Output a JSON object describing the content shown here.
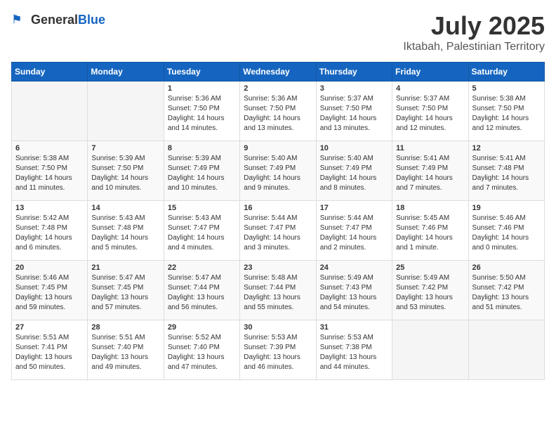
{
  "header": {
    "logo_general": "General",
    "logo_blue": "Blue",
    "month_year": "July 2025",
    "location": "Iktabah, Palestinian Territory"
  },
  "days_of_week": [
    "Sunday",
    "Monday",
    "Tuesday",
    "Wednesday",
    "Thursday",
    "Friday",
    "Saturday"
  ],
  "weeks": [
    [
      {
        "day": "",
        "info": ""
      },
      {
        "day": "",
        "info": ""
      },
      {
        "day": "1",
        "info": "Sunrise: 5:36 AM\nSunset: 7:50 PM\nDaylight: 14 hours\nand 14 minutes."
      },
      {
        "day": "2",
        "info": "Sunrise: 5:36 AM\nSunset: 7:50 PM\nDaylight: 14 hours\nand 13 minutes."
      },
      {
        "day": "3",
        "info": "Sunrise: 5:37 AM\nSunset: 7:50 PM\nDaylight: 14 hours\nand 13 minutes."
      },
      {
        "day": "4",
        "info": "Sunrise: 5:37 AM\nSunset: 7:50 PM\nDaylight: 14 hours\nand 12 minutes."
      },
      {
        "day": "5",
        "info": "Sunrise: 5:38 AM\nSunset: 7:50 PM\nDaylight: 14 hours\nand 12 minutes."
      }
    ],
    [
      {
        "day": "6",
        "info": "Sunrise: 5:38 AM\nSunset: 7:50 PM\nDaylight: 14 hours\nand 11 minutes."
      },
      {
        "day": "7",
        "info": "Sunrise: 5:39 AM\nSunset: 7:50 PM\nDaylight: 14 hours\nand 10 minutes."
      },
      {
        "day": "8",
        "info": "Sunrise: 5:39 AM\nSunset: 7:49 PM\nDaylight: 14 hours\nand 10 minutes."
      },
      {
        "day": "9",
        "info": "Sunrise: 5:40 AM\nSunset: 7:49 PM\nDaylight: 14 hours\nand 9 minutes."
      },
      {
        "day": "10",
        "info": "Sunrise: 5:40 AM\nSunset: 7:49 PM\nDaylight: 14 hours\nand 8 minutes."
      },
      {
        "day": "11",
        "info": "Sunrise: 5:41 AM\nSunset: 7:49 PM\nDaylight: 14 hours\nand 7 minutes."
      },
      {
        "day": "12",
        "info": "Sunrise: 5:41 AM\nSunset: 7:48 PM\nDaylight: 14 hours\nand 7 minutes."
      }
    ],
    [
      {
        "day": "13",
        "info": "Sunrise: 5:42 AM\nSunset: 7:48 PM\nDaylight: 14 hours\nand 6 minutes."
      },
      {
        "day": "14",
        "info": "Sunrise: 5:43 AM\nSunset: 7:48 PM\nDaylight: 14 hours\nand 5 minutes."
      },
      {
        "day": "15",
        "info": "Sunrise: 5:43 AM\nSunset: 7:47 PM\nDaylight: 14 hours\nand 4 minutes."
      },
      {
        "day": "16",
        "info": "Sunrise: 5:44 AM\nSunset: 7:47 PM\nDaylight: 14 hours\nand 3 minutes."
      },
      {
        "day": "17",
        "info": "Sunrise: 5:44 AM\nSunset: 7:47 PM\nDaylight: 14 hours\nand 2 minutes."
      },
      {
        "day": "18",
        "info": "Sunrise: 5:45 AM\nSunset: 7:46 PM\nDaylight: 14 hours\nand 1 minute."
      },
      {
        "day": "19",
        "info": "Sunrise: 5:46 AM\nSunset: 7:46 PM\nDaylight: 14 hours\nand 0 minutes."
      }
    ],
    [
      {
        "day": "20",
        "info": "Sunrise: 5:46 AM\nSunset: 7:45 PM\nDaylight: 13 hours\nand 59 minutes."
      },
      {
        "day": "21",
        "info": "Sunrise: 5:47 AM\nSunset: 7:45 PM\nDaylight: 13 hours\nand 57 minutes."
      },
      {
        "day": "22",
        "info": "Sunrise: 5:47 AM\nSunset: 7:44 PM\nDaylight: 13 hours\nand 56 minutes."
      },
      {
        "day": "23",
        "info": "Sunrise: 5:48 AM\nSunset: 7:44 PM\nDaylight: 13 hours\nand 55 minutes."
      },
      {
        "day": "24",
        "info": "Sunrise: 5:49 AM\nSunset: 7:43 PM\nDaylight: 13 hours\nand 54 minutes."
      },
      {
        "day": "25",
        "info": "Sunrise: 5:49 AM\nSunset: 7:42 PM\nDaylight: 13 hours\nand 53 minutes."
      },
      {
        "day": "26",
        "info": "Sunrise: 5:50 AM\nSunset: 7:42 PM\nDaylight: 13 hours\nand 51 minutes."
      }
    ],
    [
      {
        "day": "27",
        "info": "Sunrise: 5:51 AM\nSunset: 7:41 PM\nDaylight: 13 hours\nand 50 minutes."
      },
      {
        "day": "28",
        "info": "Sunrise: 5:51 AM\nSunset: 7:40 PM\nDaylight: 13 hours\nand 49 minutes."
      },
      {
        "day": "29",
        "info": "Sunrise: 5:52 AM\nSunset: 7:40 PM\nDaylight: 13 hours\nand 47 minutes."
      },
      {
        "day": "30",
        "info": "Sunrise: 5:53 AM\nSunset: 7:39 PM\nDaylight: 13 hours\nand 46 minutes."
      },
      {
        "day": "31",
        "info": "Sunrise: 5:53 AM\nSunset: 7:38 PM\nDaylight: 13 hours\nand 44 minutes."
      },
      {
        "day": "",
        "info": ""
      },
      {
        "day": "",
        "info": ""
      }
    ]
  ]
}
